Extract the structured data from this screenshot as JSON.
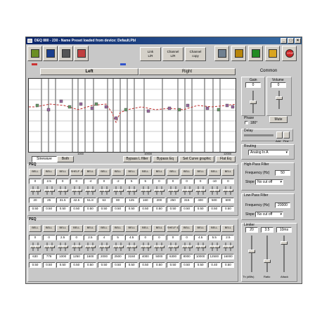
{
  "window": {
    "title": "DEQ 880 - 230 - Name Preset loaded from device: Default.Pbl"
  },
  "toolbar": {
    "buttons": [
      {
        "name": "open-icon",
        "color": "#6b8e23"
      },
      {
        "name": "save-icon",
        "color": "#1a3f8f"
      },
      {
        "name": "printer-icon",
        "color": "#555555"
      },
      {
        "name": "clipboard-icon",
        "color": "#c04040"
      }
    ],
    "middle": [
      {
        "name": "link-button",
        "lines": [
          "Link",
          "L/R"
        ]
      },
      {
        "name": "channel-button",
        "lines": [
          "Channel",
          "L/R"
        ]
      },
      {
        "name": "channel-copy-button",
        "lines": [
          "Channel",
          "copy"
        ]
      }
    ],
    "right": [
      {
        "name": "device-icon",
        "color": "#708090"
      },
      {
        "name": "network-icon",
        "color": "#b8860b"
      },
      {
        "name": "chain-icon",
        "color": "#228b22"
      },
      {
        "name": "notes-icon",
        "color": "#daa520"
      },
      {
        "name": "stop-icon",
        "color": "#cc2222",
        "label": "STOP"
      }
    ]
  },
  "tabs": {
    "left": "Left",
    "right": "Right",
    "common": "Common",
    "left_color": "#cc3333",
    "right_color": "#3355cc"
  },
  "graph": {
    "ticks": [
      "1000",
      "10000",
      "12000"
    ],
    "view_buttons": [
      "Sinewave",
      "Both"
    ],
    "actions": [
      "Bypass L filter",
      "Bypass Eq",
      "Set Curve graphic",
      "Flat Eq"
    ]
  },
  "peq": {
    "label": "PEQ",
    "rows": [
      {
        "label": "PEQ",
        "types": [
          "BELL",
          "BELL",
          "BELL",
          "SHELF -4.5",
          "BELL",
          "BELL",
          "BELL",
          "BELL",
          "BELL",
          "BELL",
          "BELL",
          "BELL",
          "BELL",
          "BELL",
          "BELL"
        ],
        "gains": [
          "0",
          "2.5",
          "0",
          "0",
          "-4",
          "0",
          "-2",
          "5",
          "5",
          "0",
          "0",
          "0",
          "0",
          "-10",
          "0"
        ],
        "freqs": [
          "20",
          "25",
          "31.5",
          "42.5",
          "51.8",
          "63",
          "80",
          "125",
          "160",
          "200",
          "250",
          "315",
          "400",
          "500",
          "600"
        ],
        "qs": [
          "0.50",
          "0.50",
          "0.50",
          "0.50",
          "0.50",
          "0.50",
          "0.50",
          "0.50",
          "0.50",
          "0.50",
          "0.50",
          "0.50",
          "0.50",
          "0.50",
          "0.50"
        ]
      },
      {
        "label": "PEQ",
        "types": [
          "BELL",
          "BELL",
          "BELL",
          "BELL",
          "BELL",
          "BELL",
          "BELL",
          "BELL",
          "BELL",
          "BELL",
          "SHELF 4.5",
          "BELL",
          "BELL",
          "BELL",
          "BELL"
        ],
        "gains": [
          "0",
          "0",
          "2.5",
          "0",
          "2.5",
          "4",
          "5",
          "4.5",
          "0",
          "0",
          "0",
          "0",
          "4.5",
          "5.5",
          "2.5"
        ],
        "freqs": [
          "630",
          "778",
          "1000",
          "1250",
          "1600",
          "2000",
          "2500",
          "3150",
          "4000",
          "5000",
          "6300",
          "8000",
          "10000",
          "12500",
          "16000"
        ],
        "qs": [
          "0.50",
          "0.50",
          "0.50",
          "0.50",
          "0.50",
          "0.50",
          "0.50",
          "0.50",
          "0.50",
          "0.50",
          "0.50",
          "0.50",
          "0.50",
          "0.40",
          "0.50"
        ]
      }
    ]
  },
  "right_panel": {
    "gain": {
      "label": "Gain",
      "value": "0"
    },
    "volume": {
      "label": "Volume",
      "value": "0"
    },
    "phase": {
      "label": "Phase",
      "option": "180°"
    },
    "mute_label": "Mute",
    "delay": {
      "label": "Delay",
      "unit_mm": "mm",
      "btn_add": "Add",
      "btn_fine": "Fine"
    },
    "routing": {
      "label": "Routing",
      "value": "Analog In A"
    },
    "highpass": {
      "label": "High-Pass Filter",
      "freq_label": "Frequency (Hz)",
      "freq_value": "50",
      "slope_label": "Slope",
      "slope_value": "No cut off"
    },
    "lowpass": {
      "label": "Low-Pass Filter",
      "freq_label": "Frequency (Hz)",
      "freq_value": "20000",
      "slope_label": "Slope",
      "slope_value": "No cut off"
    },
    "limiter": {
      "label": "Limiter",
      "values": [
        "20",
        "3.5",
        "10ms"
      ],
      "bottom_labels": [
        "Th (dBfs)",
        "Ratio",
        "Attack"
      ]
    }
  }
}
